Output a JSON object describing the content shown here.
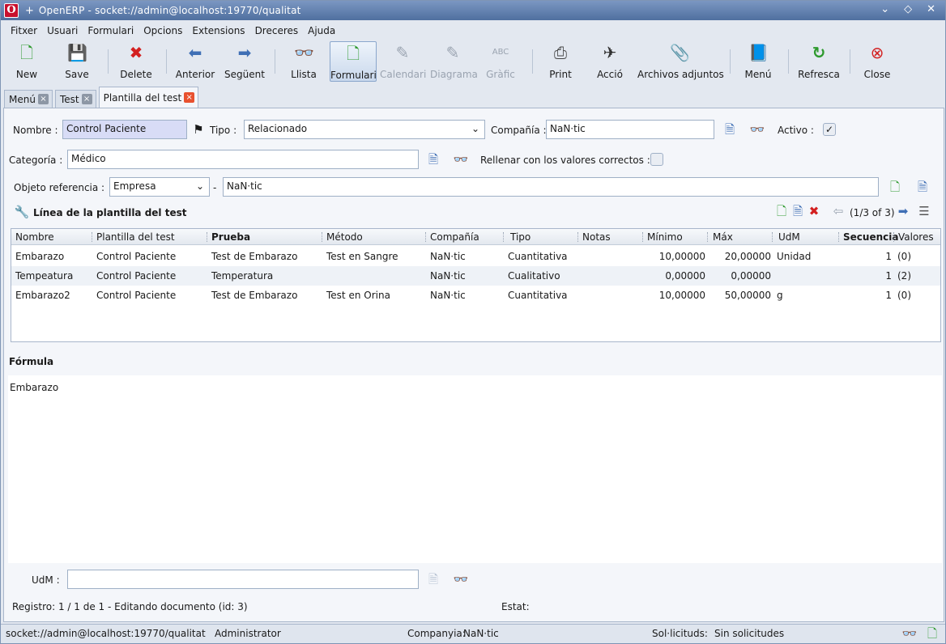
{
  "window": {
    "logo": "O",
    "pin": "+",
    "title": "OpenERP - socket://admin@localhost:19770/qualitat",
    "controls": [
      "⌄",
      "◇",
      "✕"
    ]
  },
  "menu": [
    "Fitxer",
    "Usuari",
    "Formulari",
    "Opcions",
    "Extensions",
    "Dreceres",
    "Ajuda"
  ],
  "toolbar": {
    "new": {
      "label": "New",
      "icon": "new-document-icon"
    },
    "save": {
      "label": "Save",
      "icon": "floppy-disk-icon"
    },
    "delete": {
      "label": "Delete",
      "icon": "red-x-icon"
    },
    "prev": {
      "label": "Anterior",
      "icon": "arrow-left-icon"
    },
    "next": {
      "label": "Següent",
      "icon": "arrow-right-icon"
    },
    "list": {
      "label": "Llista",
      "icon": "binoculars-icon"
    },
    "form": {
      "label": "Formulari",
      "icon": "form-icon"
    },
    "calendar": {
      "label": "Calendari",
      "icon": "pin-icon"
    },
    "diagram": {
      "label": "Diagrama",
      "icon": "pin-icon"
    },
    "graph": {
      "label": "Gràfic",
      "icon": "abc-icon"
    },
    "print": {
      "label": "Print",
      "icon": "printer-icon"
    },
    "action": {
      "label": "Acció",
      "icon": "rocket-icon"
    },
    "attachments": {
      "label": "Archivos adjuntos",
      "icon": "paperclip-icon"
    },
    "menu": {
      "label": "Menú",
      "icon": "book-icon"
    },
    "refresh": {
      "label": "Refresca",
      "icon": "refresh-icon"
    },
    "close": {
      "label": "Close",
      "icon": "close-circle-icon"
    }
  },
  "tabs": [
    {
      "label": "Menú",
      "close": "×"
    },
    {
      "label": "Test",
      "close": "×"
    },
    {
      "label": "Plantilla del test",
      "close": "×"
    }
  ],
  "form": {
    "nombre_label": "Nombre :",
    "nombre_value": "Control Paciente",
    "tipo_label": "Tipo :",
    "tipo_value": "Relacionado",
    "compania_label": "Compañía :",
    "compania_value": "NaN·tic",
    "activo_label": "Activo :",
    "activo_checked": "✓",
    "categoria_label": "Categoría :",
    "categoria_value": "Médico",
    "rellenar_label": "Rellenar con los valores correctos :",
    "objeto_label": "Objeto referencia :",
    "objeto_model": "Empresa",
    "objeto_sep": "-",
    "objeto_value": "NaN·tic"
  },
  "lines": {
    "section_title": "Línea de la plantilla del test",
    "pager": "(1/3 of 3)",
    "columns": [
      "Nombre",
      "Plantilla del test",
      "Prueba",
      "Método",
      "Compañía",
      "Tipo",
      "Notas",
      "Mínimo",
      "Máx",
      "UdM",
      "Secuencia",
      "Valores"
    ],
    "rows": [
      [
        "Embarazo",
        "Control Paciente",
        "Test de Embarazo",
        "Test en Sangre",
        "NaN·tic",
        "Cuantitativa",
        "",
        "10,00000",
        "20,00000",
        "Unidad",
        "1",
        "(0)"
      ],
      [
        "Tempeatura",
        "Control Paciente",
        "Temperatura",
        "",
        "NaN·tic",
        "Cualitativo",
        "",
        "0,00000",
        "0,00000",
        "",
        "1",
        "(2)"
      ],
      [
        "Embarazo2",
        "Control Paciente",
        "Test de Embarazo",
        "Test en Orina",
        "NaN·tic",
        "Cuantitativa",
        "",
        "10,00000",
        "50,00000",
        "g",
        "1",
        "(0)"
      ]
    ]
  },
  "formula": {
    "title": "Fórmula",
    "text": "Embarazo"
  },
  "udm": {
    "label": "UdM :",
    "value": ""
  },
  "record_status": "Registro: 1 / 1 de 1 - Editando documento (id: 3)",
  "estat_label": "Estat:",
  "statusbar": {
    "connection": "socket://admin@localhost:19770/qualitat",
    "user": "Administrator",
    "company_label": "Companyia:",
    "company": "NaN·tic",
    "requests_label": "Sol·licituds:",
    "requests": "Sin solicitudes"
  }
}
